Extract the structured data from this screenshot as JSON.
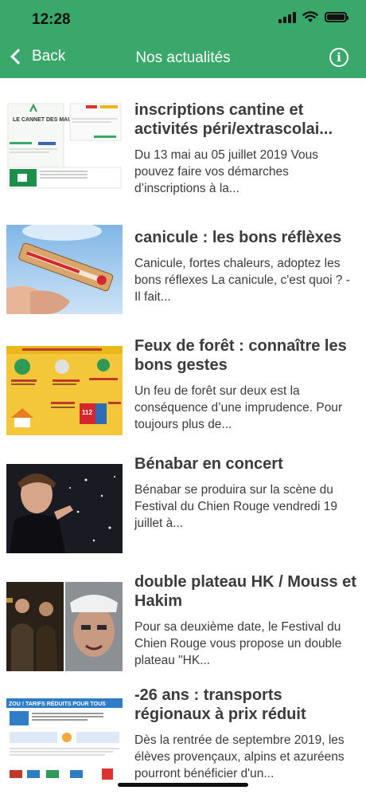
{
  "status_bar": {
    "time": "12:28"
  },
  "nav": {
    "back_label": "Back",
    "title": "Nos actualités",
    "info_icon": "info-circle-icon"
  },
  "articles": [
    {
      "title": "inscriptions cantine et activités péri/extrascolai...",
      "excerpt": " Du 13 mai au 05 juillet 2019 Vous pouvez faire vos démarches d’inscriptions à la...",
      "thumb_logo": "LE CANNET DES MAURES"
    },
    {
      "title": "canicule : les bons réflèxes",
      "excerpt": "Canicule, fortes chaleurs, adoptez les bons réflexes La canicule, c'est quoi ? - Il fait..."
    },
    {
      "title": "Feux de forêt : connaître les bons gestes",
      "excerpt": "Un feu de forêt sur deux est la conséquence d’une imprudence. Pour toujours plus de..."
    },
    {
      "title": "Bénabar en concert",
      "excerpt": "Bénabar se produira sur la scène du Festival du Chien Rouge vendredi 19 juillet à..."
    },
    {
      "title": "double plateau HK / Mouss et Hakim",
      "excerpt": "Pour sa deuxième date, le Festival du Chien Rouge vous propose un double plateau \"HK..."
    },
    {
      "title": "-26 ans : transports régionaux à prix réduit",
      "excerpt": "Dès la rentrée de septembre 2019, les élèves provençaux, alpins et azuréens pourront bénéficier d'un...",
      "thumb_banner": "ZOU ! TARIFS RÉDUITS POUR TOUS"
    }
  ]
}
